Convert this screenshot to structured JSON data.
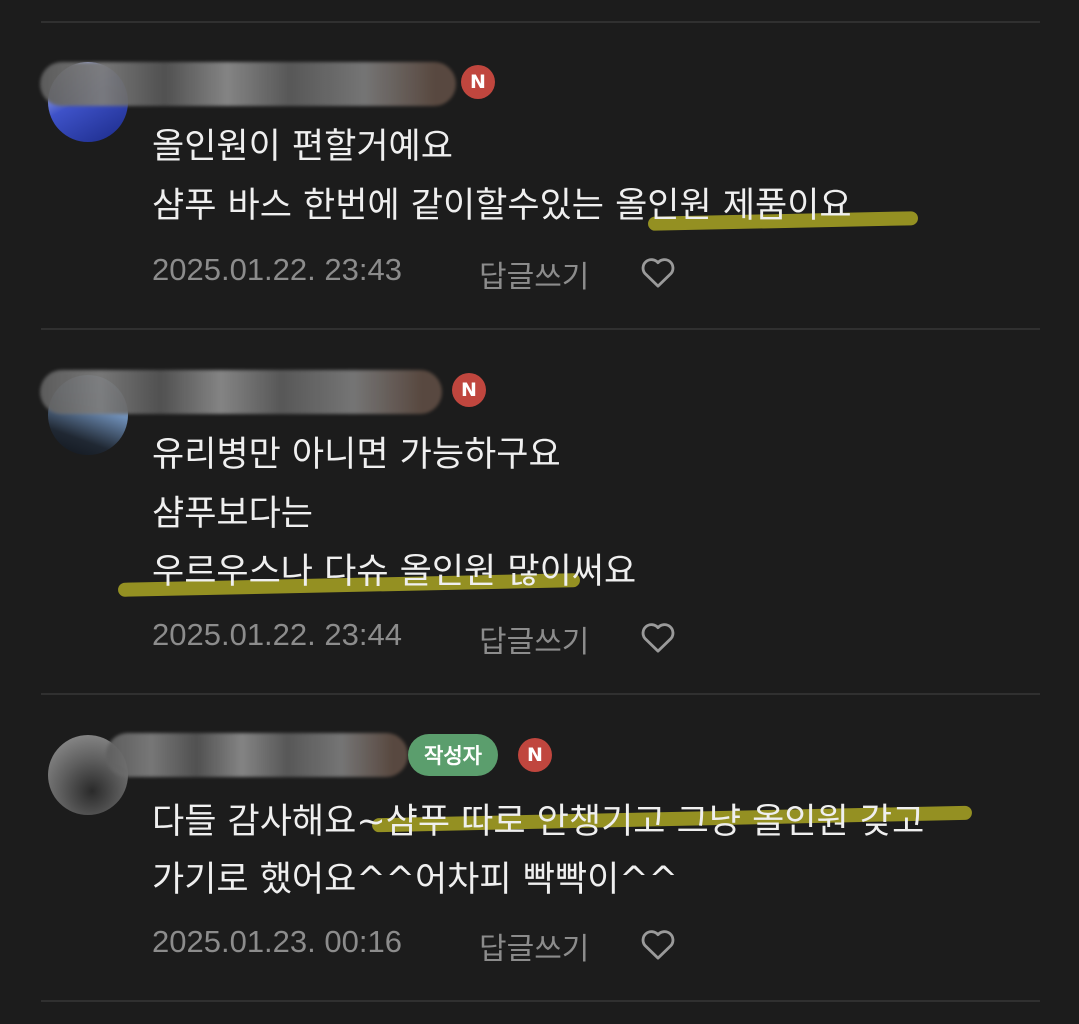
{
  "comments": [
    {
      "avatar": "profile-avatar-blurred",
      "badges": {
        "new": "N",
        "author": ""
      },
      "lines": [
        "올인원이 편할거예요",
        "샴푸 바스 한번에 같이할수있는 올인원 제품이요"
      ],
      "timestamp": "2025.01.22. 23:43",
      "reply_label": "답글쓰기",
      "like_icon": "heart-outline-icon"
    },
    {
      "avatar": "profile-avatar-blurred",
      "badges": {
        "new": "N",
        "author": ""
      },
      "lines": [
        "유리병만 아니면 가능하구요",
        "샴푸보다는",
        "우르우스나 다슈 올인원 많이써요"
      ],
      "timestamp": "2025.01.22. 23:44",
      "reply_label": "답글쓰기",
      "like_icon": "heart-outline-icon"
    },
    {
      "avatar": "profile-avatar-blurred",
      "badges": {
        "new": "N",
        "author": "작성자"
      },
      "lines": [
        "다들 감사해요~샴푸 따로 안챙기고 그냥 올인원 갖고",
        "가기로 했어요^^어차피 빡빡이^^"
      ],
      "timestamp": "2025.01.23. 00:16",
      "reply_label": "답글쓰기",
      "like_icon": "heart-outline-icon"
    }
  ],
  "colors": {
    "background": "#1c1c1c",
    "text": "#efefef",
    "meta_text": "#8c8c8c",
    "new_badge": "#c0463e",
    "author_badge": "#5b9e6d",
    "highlighter": "#c4be26"
  }
}
